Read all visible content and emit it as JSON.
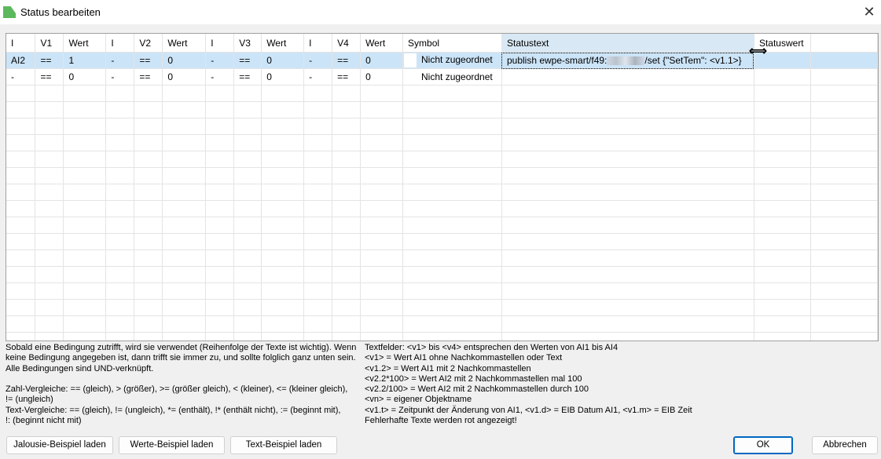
{
  "window": {
    "title": "Status bearbeiten"
  },
  "table": {
    "headers": [
      "I",
      "V1",
      "Wert",
      "I",
      "V2",
      "Wert",
      "I",
      "V3",
      "Wert",
      "I",
      "V4",
      "Wert",
      "Symbol",
      "Statustext",
      "Statuswert"
    ],
    "rows": [
      {
        "cells": [
          "AI2",
          "==",
          "1",
          "-",
          "==",
          "0",
          "-",
          "==",
          "0",
          "-",
          "==",
          "0"
        ],
        "symbol": "Nicht zugeordnet",
        "statustext_prefix": "publish ewpe-smart/f49:",
        "statustext_suffix": "/set {\"SetTem\": <v1.1>}",
        "statuswert": ""
      },
      {
        "cells": [
          "-",
          "==",
          "0",
          "-",
          "==",
          "0",
          "-",
          "==",
          "0",
          "-",
          "==",
          "0"
        ],
        "symbol": "Nicht zugeordnet",
        "statustext_prefix": "",
        "statustext_suffix": "",
        "statuswert": ""
      }
    ]
  },
  "help_left": [
    "Sobald eine Bedingung zutrifft, wird sie verwendet (Reihenfolge der Texte ist wichtig). Wenn",
    "keine Bedingung angegeben ist, dann trifft sie immer zu, und sollte folglich ganz unten sein.",
    "Alle Bedingungen sind UND-verknüpft.",
    "",
    "Zahl-Vergleiche: == (gleich), > (größer), >= (größer gleich), < (kleiner), <= (kleiner gleich),",
    "!= (ungleich)",
    "Text-Vergleiche: == (gleich), != (ungleich), *= (enthält), !* (enthält nicht), := (beginnt mit),",
    "!: (beginnt nicht mit)"
  ],
  "help_right": [
    "Textfelder: <v1> bis <v4> entsprechen den Werten von AI1 bis AI4",
    "<v1> = Wert AI1 ohne Nachkommastellen oder Text",
    "<v1.2> = Wert AI1 mit 2 Nachkommastellen",
    "<v2.2*100> = Wert AI2 mit 2 Nachkommastellen mal 100",
    "<v2.2/100> = Wert AI2 mit 2 Nachkommastellen durch 100",
    "<vn> = eigener Objektname",
    "<v1.t> = Zeitpunkt der Änderung von AI1, <v1.d> = EIB Datum AI1, <v1.m> = EIB Zeit",
    "Fehlerhafte Texte werden rot angezeigt!"
  ],
  "buttons": {
    "jalousie": "Jalousie-Beispiel laden",
    "werte": "Werte-Beispiel laden",
    "text": "Text-Beispiel laden",
    "ok": "OK",
    "cancel": "Abbrechen"
  }
}
